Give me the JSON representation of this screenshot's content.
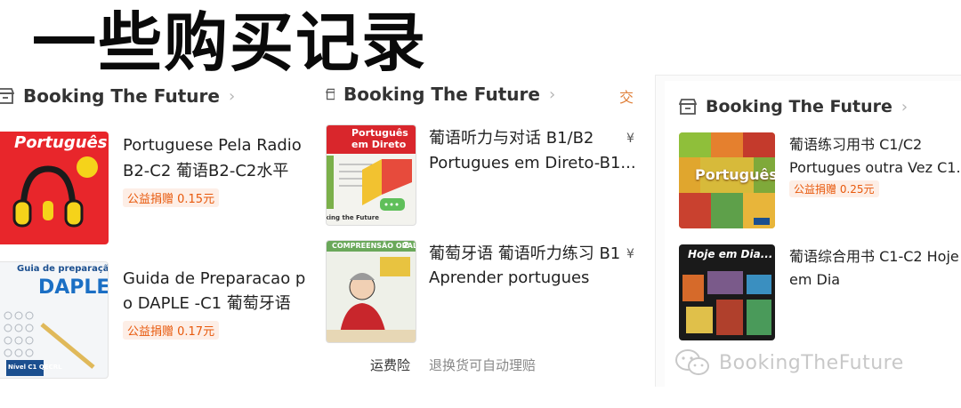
{
  "page_title": "一些购买记录",
  "panels": [
    {
      "shop_name": "Booking The Future",
      "items": [
        {
          "line1": "Portuguese Pela Radio",
          "line2": "B2-C2 葡语B2-C2水平",
          "tag": "公益捐赠 0.15元",
          "cover": {
            "title": "Português pela Rádio"
          }
        },
        {
          "line1": "Guida de Preparacao p",
          "line2": "o DAPLE -C1 葡萄牙语",
          "tag": "公益捐赠 0.17元",
          "cover": {
            "title_top": "Guia de preparação para o",
            "title_main": "DAPLE",
            "level": "Nível C1 QECRL"
          }
        }
      ]
    },
    {
      "shop_name": "Booking The Future",
      "corner_char": "交",
      "items": [
        {
          "line1": "葡语听力与对话 B1/B2",
          "line2": "Portugues em Direto-B1...",
          "price": "¥",
          "cover": {
            "title": "Português em Direto",
            "footer": "king the Future"
          }
        },
        {
          "line1": "葡萄牙语 葡语听力练习 B1",
          "line2": "Aprender portugues",
          "price": "¥",
          "cover": {
            "title": "COMPREENSÃO ORAL",
            "number": "2"
          }
        }
      ],
      "footer_label": "运费险",
      "footer_text": "退换货可自动理赔"
    },
    {
      "shop_name": "Booking The Future",
      "items": [
        {
          "line1": "葡语练习用书 C1/C2",
          "line2": "Portugues outra Vez C1...",
          "tag": "公益捐赠 0.25元",
          "cover": {
            "title": "Português outra Vez"
          }
        },
        {
          "line1": "葡语综合用书 C1-C2 Hoje",
          "line2": "em Dia",
          "cover": {
            "title": "Hoje em Dia..."
          }
        }
      ]
    }
  ],
  "watermark": "BookingTheFuture"
}
